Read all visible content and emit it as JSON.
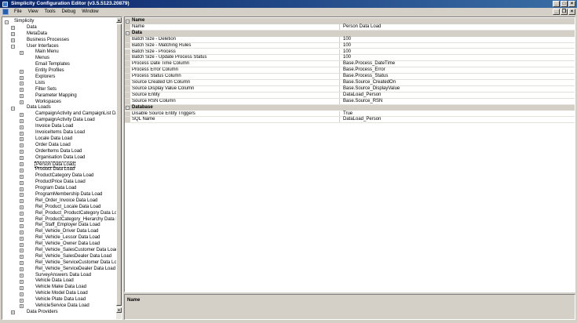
{
  "window": {
    "title": "Simplicity Configuration Editor (v3.5.5123.20879)",
    "minimize": "_",
    "maximize": "□",
    "close": "×"
  },
  "menu": {
    "items": [
      "File",
      "View",
      "Tools",
      "Debug",
      "Window"
    ],
    "mdi_minimize": "_",
    "mdi_restore": "❐",
    "mdi_close": "×"
  },
  "tree": {
    "rows": [
      {
        "label": "Simplicity",
        "level": 0,
        "expander": "−"
      },
      {
        "label": "Data",
        "level": 1,
        "expander": "+"
      },
      {
        "label": "MetaData",
        "level": 1,
        "expander": "+"
      },
      {
        "label": "Business Processes",
        "level": 1,
        "expander": "+"
      },
      {
        "label": "User Interfaces",
        "level": 1,
        "expander": "−"
      },
      {
        "label": "Main Menu",
        "level": 2,
        "expander": "+"
      },
      {
        "label": "Menus",
        "level": 2,
        "expander": ""
      },
      {
        "label": "Email Templates",
        "level": 2,
        "expander": ""
      },
      {
        "label": "Entity Profiles",
        "level": 2,
        "expander": "+"
      },
      {
        "label": "Explorers",
        "level": 2,
        "expander": "+"
      },
      {
        "label": "Lists",
        "level": 2,
        "expander": "+"
      },
      {
        "label": "Filter Sets",
        "level": 2,
        "expander": "+"
      },
      {
        "label": "Parameter Mapping",
        "level": 2,
        "expander": "+"
      },
      {
        "label": "Workspaces",
        "level": 2,
        "expander": "+"
      },
      {
        "label": "Data Loads",
        "level": 1,
        "expander": "−"
      },
      {
        "label": "CampaignActivity and CampaignList Data Load",
        "level": 2,
        "expander": "+"
      },
      {
        "label": "CampaignActivity Data Load",
        "level": 2,
        "expander": "+"
      },
      {
        "label": "Invoice Data Load",
        "level": 2,
        "expander": "+"
      },
      {
        "label": "InvoiceItems Data Load",
        "level": 2,
        "expander": "+"
      },
      {
        "label": "Locale Data Load",
        "level": 2,
        "expander": "+"
      },
      {
        "label": "Order Data Load",
        "level": 2,
        "expander": "+"
      },
      {
        "label": "OrderItems Data Load",
        "level": 2,
        "expander": "+"
      },
      {
        "label": "Organisation Data Load",
        "level": 2,
        "expander": "+"
      },
      {
        "label": "Person Data Load",
        "level": 2,
        "expander": "+",
        "selected": true
      },
      {
        "label": "Product Data Load",
        "level": 2,
        "expander": "+"
      },
      {
        "label": "ProductCategory Data Load",
        "level": 2,
        "expander": "+"
      },
      {
        "label": "ProductPrice Data Load",
        "level": 2,
        "expander": "+"
      },
      {
        "label": "Program Data Load",
        "level": 2,
        "expander": "+"
      },
      {
        "label": "ProgramMembership Data Load",
        "level": 2,
        "expander": "+"
      },
      {
        "label": "Rel_Order_Invoice Data Load",
        "level": 2,
        "expander": "+"
      },
      {
        "label": "Rel_Product_Locale Data Load",
        "level": 2,
        "expander": "+"
      },
      {
        "label": "Rel_Product_ProductCategory Data Load",
        "level": 2,
        "expander": "+"
      },
      {
        "label": "Rel_ProductCategory_Hierarchy Data Load",
        "level": 2,
        "expander": "+"
      },
      {
        "label": "Rel_Staff_Employer Data Load",
        "level": 2,
        "expander": "+"
      },
      {
        "label": "Rel_Vehicle_Driver Data Load",
        "level": 2,
        "expander": "+"
      },
      {
        "label": "Rel_Vehicle_Lessor Data Load",
        "level": 2,
        "expander": "+"
      },
      {
        "label": "Rel_Vehicle_Owner Data Load",
        "level": 2,
        "expander": "+"
      },
      {
        "label": "Rel_Vehicle_SalesCustomer Data Load",
        "level": 2,
        "expander": "+"
      },
      {
        "label": "Rel_Vehicle_SalesDealer Data Load",
        "level": 2,
        "expander": "+"
      },
      {
        "label": "Rel_Vehicle_ServiceCustomer Data Load",
        "level": 2,
        "expander": "+"
      },
      {
        "label": "Rel_Vehicle_ServiceDealer Data Load",
        "level": 2,
        "expander": "+"
      },
      {
        "label": "SurveyAnswers Data Load",
        "level": 2,
        "expander": "+"
      },
      {
        "label": "Vehicle Data Load",
        "level": 2,
        "expander": "+"
      },
      {
        "label": "Vehicle Make Data Load",
        "level": 2,
        "expander": "+"
      },
      {
        "label": "Vehicle Model Data Load",
        "level": 2,
        "expander": "+"
      },
      {
        "label": "Vehicle Plate Data Load",
        "level": 2,
        "expander": "+"
      },
      {
        "label": "VehicleService Data Load",
        "level": 2,
        "expander": "+"
      },
      {
        "label": "Data Providers",
        "level": 1,
        "expander": "+"
      }
    ]
  },
  "properties": {
    "rows": [
      {
        "kind": "category",
        "label": "Name",
        "toggle": "−"
      },
      {
        "kind": "prop",
        "name": "Name",
        "value": "Person Data Load"
      },
      {
        "kind": "category",
        "label": "Data",
        "toggle": "−"
      },
      {
        "kind": "prop",
        "name": "Batch Size - Deletion",
        "value": "100"
      },
      {
        "kind": "prop",
        "name": "Batch Size - Matching Rules",
        "value": "100"
      },
      {
        "kind": "prop",
        "name": "Batch Size - Process",
        "value": "100"
      },
      {
        "kind": "prop",
        "name": "Batch Size - Update Process Status",
        "value": "100"
      },
      {
        "kind": "prop",
        "name": "Process Date Time Column",
        "value": "Base.Process_DateTime"
      },
      {
        "kind": "prop",
        "name": "Process Error Column",
        "value": "Base.Process_Error"
      },
      {
        "kind": "prop",
        "name": "Process Status Column",
        "value": "Base.Process_Status"
      },
      {
        "kind": "prop",
        "name": "Source Created On Column",
        "value": "Base.Source_CreatedOn"
      },
      {
        "kind": "prop",
        "name": "Source Display Value Column",
        "value": "Base.Source_DisplayValue"
      },
      {
        "kind": "prop",
        "name": "Source Entity",
        "value": "DataLoad_Person"
      },
      {
        "kind": "prop",
        "name": "Source RSN Column",
        "value": "Base.Source_RSN"
      },
      {
        "kind": "category",
        "label": "Database",
        "toggle": "−"
      },
      {
        "kind": "prop",
        "name": "Disable Source Entity Triggers",
        "value": "True"
      },
      {
        "kind": "prop",
        "name": "SQL Name",
        "value": "DataLoad_Person"
      }
    ]
  },
  "description": {
    "title": "Name"
  }
}
